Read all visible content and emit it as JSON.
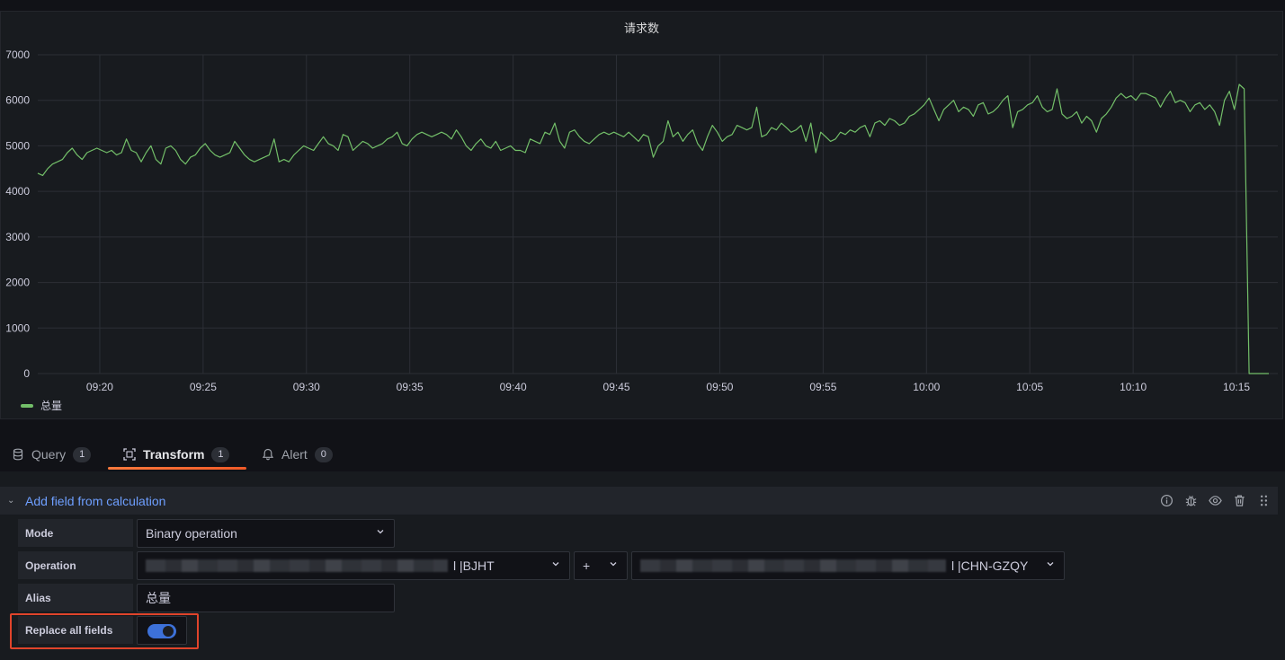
{
  "panel": {
    "title": "请求数",
    "legend": [
      {
        "name": "总量",
        "color": "#73bf69"
      }
    ]
  },
  "chart_data": {
    "type": "line",
    "title": "请求数",
    "x_ticks": [
      "09:20",
      "09:25",
      "09:30",
      "09:35",
      "09:40",
      "09:45",
      "09:50",
      "09:55",
      "10:00",
      "10:05",
      "10:10",
      "10:15"
    ],
    "y_ticks": [
      0,
      1000,
      2000,
      3000,
      4000,
      5000,
      6000,
      7000
    ],
    "ylim": [
      0,
      7000
    ],
    "x_start": "09:17",
    "x_end": "10:17",
    "grid": true,
    "legend_position": "bottom-left",
    "series": [
      {
        "name": "总量",
        "color": "#73bf69",
        "values": [
          4400,
          4350,
          4500,
          4600,
          4650,
          4700,
          4850,
          4950,
          4800,
          4700,
          4850,
          4900,
          4950,
          4900,
          4850,
          4900,
          4800,
          4850,
          5150,
          4900,
          4850,
          4650,
          4850,
          5000,
          4700,
          4600,
          4950,
          5000,
          4900,
          4700,
          4600,
          4750,
          4800,
          4950,
          5050,
          4900,
          4800,
          4750,
          4800,
          4850,
          5100,
          4950,
          4800,
          4700,
          4650,
          4700,
          4750,
          4800,
          5150,
          4650,
          4700,
          4650,
          4800,
          4900,
          5000,
          4950,
          4900,
          5050,
          5200,
          5050,
          5000,
          4900,
          5250,
          5200,
          4900,
          5000,
          5100,
          5050,
          4950,
          5000,
          5050,
          5150,
          5200,
          5300,
          5050,
          5000,
          5150,
          5250,
          5300,
          5250,
          5200,
          5250,
          5300,
          5250,
          5150,
          5350,
          5200,
          5000,
          4900,
          5050,
          5150,
          5000,
          4950,
          5100,
          4900,
          4950,
          5000,
          4900,
          4900,
          4850,
          5150,
          5100,
          5050,
          5300,
          5250,
          5500,
          5100,
          4950,
          5300,
          5350,
          5200,
          5100,
          5050,
          5150,
          5250,
          5300,
          5250,
          5300,
          5250,
          5200,
          5300,
          5200,
          5100,
          5250,
          5200,
          4750,
          5000,
          5100,
          5550,
          5200,
          5300,
          5100,
          5250,
          5350,
          5050,
          4900,
          5200,
          5450,
          5300,
          5100,
          5200,
          5250,
          5450,
          5400,
          5350,
          5400,
          5850,
          5200,
          5250,
          5400,
          5350,
          5500,
          5400,
          5300,
          5350,
          5450,
          5100,
          5500,
          4850,
          5300,
          5200,
          5100,
          5150,
          5300,
          5250,
          5350,
          5300,
          5400,
          5450,
          5200,
          5500,
          5550,
          5450,
          5600,
          5550,
          5450,
          5500,
          5650,
          5700,
          5800,
          5900,
          6050,
          5800,
          5550,
          5800,
          5900,
          6000,
          5750,
          5850,
          5800,
          5650,
          5900,
          5950,
          5700,
          5750,
          5850,
          6000,
          6100,
          5400,
          5750,
          5800,
          5900,
          5950,
          6100,
          5850,
          5750,
          5800,
          6250,
          5700,
          5600,
          5650,
          5750,
          5500,
          5650,
          5550,
          5300,
          5600,
          5700,
          5850,
          6050,
          6150,
          6050,
          6100,
          6000,
          6150,
          6150,
          6100,
          6050,
          5850,
          6050,
          6200,
          5950,
          6000,
          5950,
          5750,
          5900,
          5950,
          5800,
          5900,
          5750,
          5450,
          6000,
          6200,
          5800,
          6350,
          6250,
          0,
          0,
          0,
          0,
          0
        ]
      }
    ]
  },
  "tabs": [
    {
      "label": "Query",
      "count": "1",
      "icon": "database-icon"
    },
    {
      "label": "Transform",
      "count": "1",
      "icon": "transform-icon"
    },
    {
      "label": "Alert",
      "count": "0",
      "icon": "bell-icon"
    }
  ],
  "transform": {
    "title": "Add field from calculation",
    "actions": [
      "info-icon",
      "bug-icon",
      "eye-icon",
      "trash-icon",
      "drag-handle-icon"
    ],
    "mode_label": "Mode",
    "mode_value": "Binary operation",
    "operation_label": "Operation",
    "operation_left_suffix": "l |BJHT",
    "operation_operator": "+",
    "operation_right_suffix": "l |CHN-GZQY",
    "alias_label": "Alias",
    "alias_value": "总量",
    "replace_label": "Replace all fields",
    "replace_enabled": true
  },
  "colors": {
    "series": "#73bf69",
    "accent_blue": "#6e9fff",
    "tab_underline": "#f05a28",
    "highlight_border": "#e0442b",
    "toggle_on": "#3d71d9"
  }
}
